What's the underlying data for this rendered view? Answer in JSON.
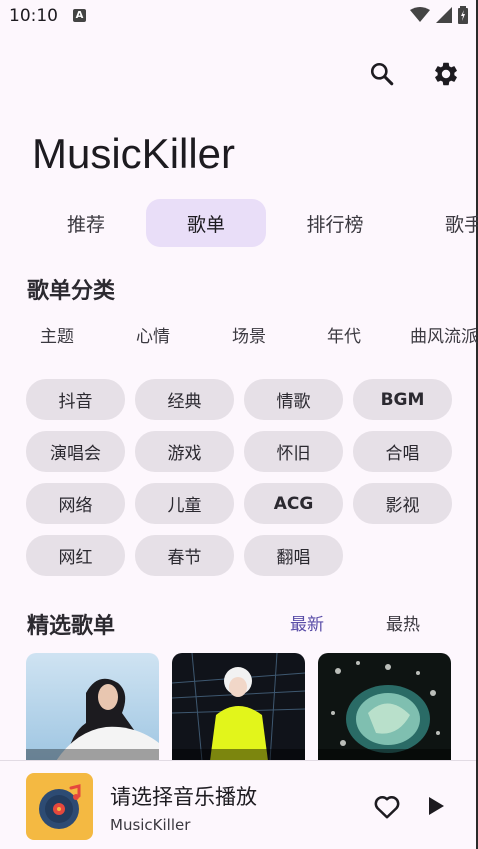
{
  "status_bar": {
    "time": "10:10",
    "notification_badge": "A"
  },
  "toolbar": {
    "search_icon": "search-icon",
    "settings_icon": "gear-icon"
  },
  "app": {
    "title": "MusicKiller"
  },
  "tabs": [
    {
      "label": "推荐",
      "active": false
    },
    {
      "label": "歌单",
      "active": true
    },
    {
      "label": "排行榜",
      "active": false
    },
    {
      "label": "歌手",
      "active": false
    }
  ],
  "category_section": {
    "title": "歌单分类",
    "subtabs": [
      "主题",
      "心情",
      "场景",
      "年代",
      "曲风流派"
    ],
    "chips": [
      "抖音",
      "经典",
      "情歌",
      "BGM",
      "演唱会",
      "游戏",
      "怀旧",
      "合唱",
      "网络",
      "儿童",
      "ACG",
      "影视",
      "网红",
      "春节",
      "翻唱"
    ]
  },
  "featured_section": {
    "title": "精选歌单",
    "sort_options": [
      {
        "label": "最新",
        "active": true
      },
      {
        "label": "最热",
        "active": false
      }
    ]
  },
  "player": {
    "title": "请选择音乐播放",
    "subtitle": "MusicKiller",
    "colors": {
      "album_bg": "#f4b942",
      "accent": "#5a4ea8"
    }
  }
}
